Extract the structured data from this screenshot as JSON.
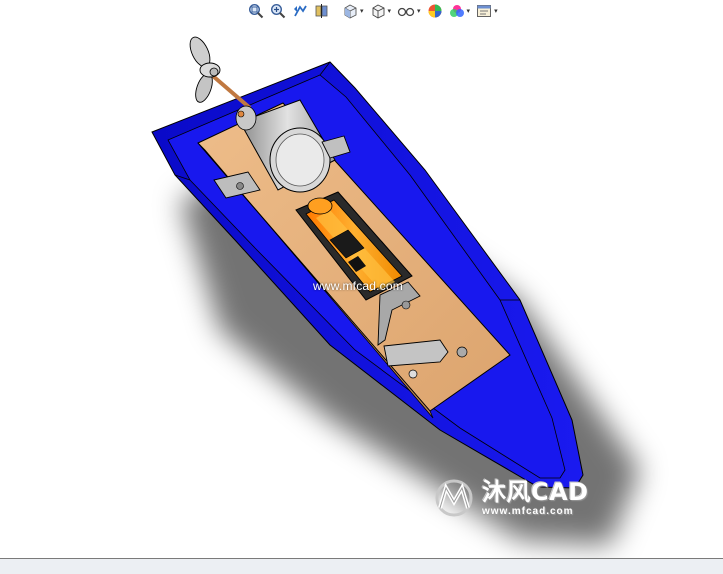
{
  "toolbar": {
    "buttons": [
      {
        "name": "zoom-to-fit-icon",
        "has_dropdown": false
      },
      {
        "name": "zoom-to-area-icon",
        "has_dropdown": false
      },
      {
        "name": "previous-view-icon",
        "has_dropdown": false
      },
      {
        "name": "section-view-icon",
        "has_dropdown": false
      },
      {
        "name": "view-orientation-icon",
        "has_dropdown": true
      },
      {
        "name": "display-style-icon",
        "has_dropdown": true
      },
      {
        "name": "hide-show-items-icon",
        "has_dropdown": true
      },
      {
        "name": "edit-appearance-icon",
        "has_dropdown": false
      },
      {
        "name": "apply-scene-icon",
        "has_dropdown": true
      },
      {
        "name": "view-settings-icon",
        "has_dropdown": true
      }
    ],
    "dropdown_glyph": "▾"
  },
  "viewport": {
    "watermark_text": "www.mfcad.com",
    "logo": {
      "title": "沐风CAD",
      "url": "www.mfcad.com"
    }
  },
  "colors": {
    "hull": "#1515e6",
    "hull_dark": "#0707a8",
    "deck_wood": "#e8b47e",
    "battery": "#ff9a10",
    "metal": "#b9b9b9",
    "background": "#ffffff",
    "status_bar": "#eceff3"
  }
}
